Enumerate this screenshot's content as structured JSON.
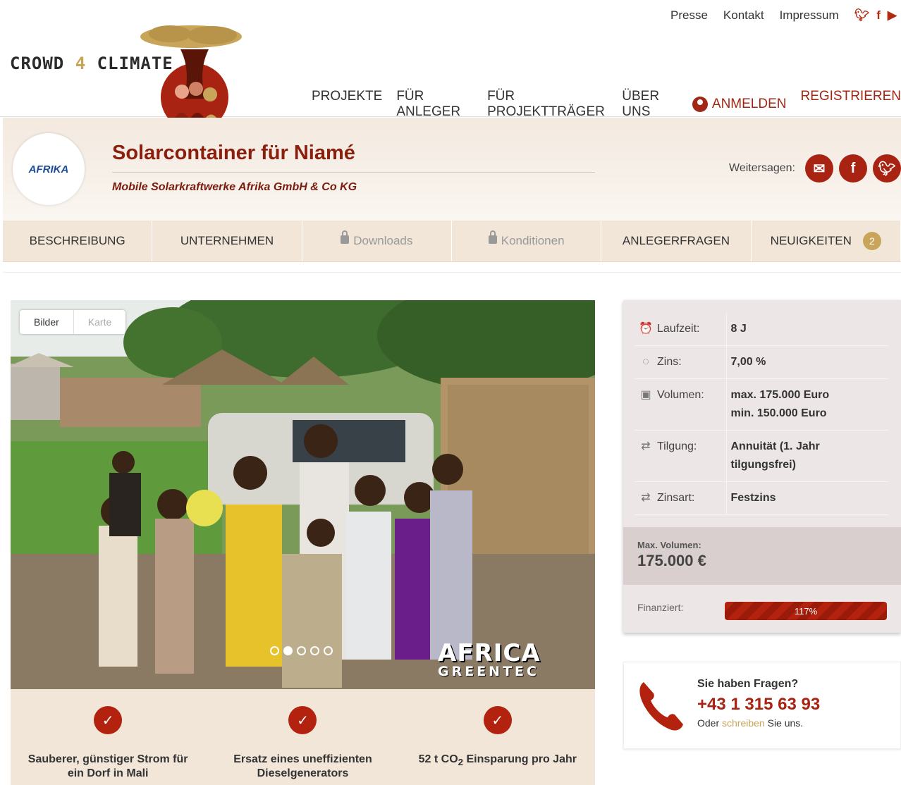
{
  "header": {
    "top_links": [
      "Presse",
      "Kontakt",
      "Impressum"
    ],
    "social_icons": [
      "twitter-icon",
      "facebook-icon",
      "youtube-icon"
    ],
    "logo_prefix": "CROWD",
    "logo_four": "4",
    "logo_suffix": "CLIMATE",
    "nav": [
      "PROJEKTE",
      "FÜR ANLEGER",
      "FÜR PROJEKTTRÄGER",
      "ÜBER UNS"
    ],
    "login_label": "ANMELDEN",
    "register_label": "REGISTRIEREN",
    "accent_color": "#a02814"
  },
  "project": {
    "logo_text": "AFRIKA",
    "title": "Solarcontainer für Niamé",
    "subtitle": "Mobile Solarkraftwerke Afrika GmbH & Co KG",
    "share_label": "Weitersagen:",
    "share_icons": [
      "email-icon",
      "facebook-icon",
      "twitter-icon"
    ]
  },
  "tabs": [
    {
      "label": "BESCHREIBUNG",
      "locked": false
    },
    {
      "label": "UNTERNEHMEN",
      "locked": false
    },
    {
      "label": "Downloads",
      "locked": true
    },
    {
      "label": "Konditionen",
      "locked": true
    },
    {
      "label": "ANLEGERFRAGEN",
      "locked": false
    },
    {
      "label": "NEUIGKEITEN",
      "locked": false,
      "badge": "2"
    }
  ],
  "gallery": {
    "toggle_active": "Bilder",
    "toggle_inactive": "Karte",
    "slide_count": 5,
    "active_slide": 2,
    "watermark_line1": "AFRICA",
    "watermark_line2": "GREENTEC"
  },
  "features": [
    {
      "text": "Sauberer, günstiger Strom für ein Dorf in Mali"
    },
    {
      "text": "Ersatz eines uneffizienten Dieselgenerators"
    },
    {
      "text_prefix": "52 t CO",
      "text_sub": "2",
      "text_suffix": " Einsparung pro Jahr"
    }
  ],
  "conditions": {
    "rows": [
      {
        "icon": "clock-icon",
        "label": "Laufzeit:",
        "value": "8 J"
      },
      {
        "icon": "piggybank-icon",
        "label": "Zins:",
        "value": "7,00 %"
      },
      {
        "icon": "money-icon",
        "label": "Volumen:",
        "value": "max. 175.000 Euro",
        "value2": "min. 150.000 Euro"
      },
      {
        "icon": "repeat-icon",
        "label": "Tilgung:",
        "value": "Annuität (1. Jahr",
        "value2": "tilgungsfrei)"
      },
      {
        "icon": "repeat-icon",
        "label": "Zinsart:",
        "value": "Festzins"
      }
    ],
    "max_volume_label": "Max. Volumen:",
    "max_volume_value": "175.000 €",
    "funded_label": "Finanziert:",
    "funded_percent": "117%",
    "funded_fraction": 1.17
  },
  "contact": {
    "question": "Sie haben Fragen?",
    "phone": "+43 1 315 63 93",
    "write_prefix": "Oder ",
    "write_link": "schreiben",
    "write_suffix": " Sie uns."
  }
}
